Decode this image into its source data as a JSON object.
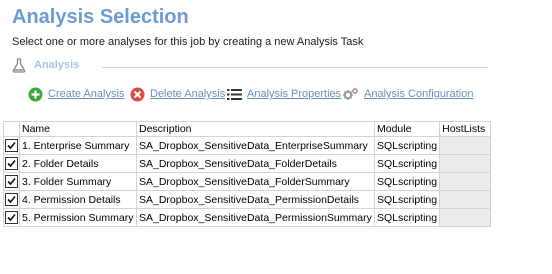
{
  "header": {
    "title": "Analysis Selection",
    "subtitle": "Select one or more analyses for this job by creating a new Analysis Task"
  },
  "section": {
    "label": "Analysis",
    "icon": "flask-icon"
  },
  "toolbar": {
    "create_label": "Create Analysis",
    "delete_label": "Delete Analysis",
    "properties_label": "Analysis Properties",
    "configuration_label": "Analysis Configuration"
  },
  "table": {
    "columns": [
      "Name",
      "Description",
      "Module",
      "HostLists"
    ],
    "rows": [
      {
        "checked": true,
        "name": "1. Enterprise Summary",
        "description": "SA_Dropbox_SensitiveData_EnterpriseSummary",
        "module": "SQLscripting",
        "hostlists": ""
      },
      {
        "checked": true,
        "name": "2. Folder Details",
        "description": "SA_Dropbox_SensitiveData_FolderDetails",
        "module": "SQLscripting",
        "hostlists": ""
      },
      {
        "checked": true,
        "name": "3. Folder Summary",
        "description": "SA_Dropbox_SensitiveData_FolderSummary",
        "module": "SQLscripting",
        "hostlists": ""
      },
      {
        "checked": true,
        "name": "4. Permission Details",
        "description": "SA_Dropbox_SensitiveData_PermissionDetails",
        "module": "SQLscripting",
        "hostlists": ""
      },
      {
        "checked": true,
        "name": "5. Permission Summary",
        "description": "SA_Dropbox_SensitiveData_PermissionSummary",
        "module": "SQLscripting",
        "hostlists": ""
      }
    ]
  },
  "colors": {
    "title": "#6c9bd2",
    "link": "#6b8fb8",
    "create_icon": "#3aa83a",
    "delete_icon": "#e04848"
  }
}
